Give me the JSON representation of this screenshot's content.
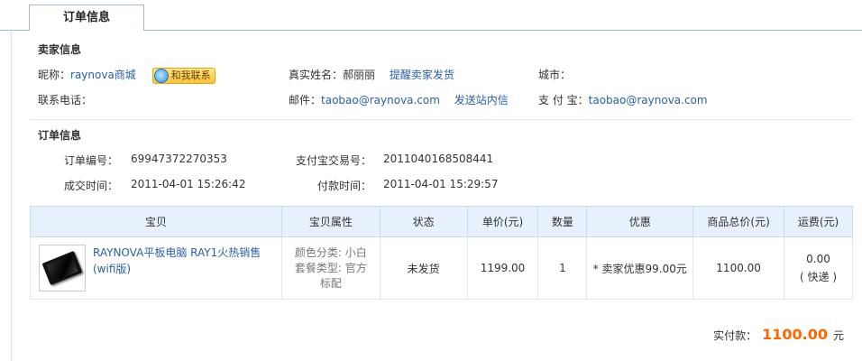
{
  "tab": {
    "label": "订单信息"
  },
  "seller": {
    "section_title": "卖家信息",
    "nickname_label": "昵称：",
    "nickname": "raynova商城",
    "contact_badge": "和我联系",
    "realname_label": "真实姓名：",
    "realname": "郝丽丽",
    "remind_link": "提醒卖家发货",
    "city_label": "城市：",
    "phone_label": "联系电话：",
    "email_label": "邮件：",
    "email": "taobao@raynova.com",
    "message_link": "发送站内信",
    "alipay_label": "支 付 宝：",
    "alipay": "taobao@raynova.com"
  },
  "order": {
    "section_title": "订单信息",
    "order_no_label": "订单编号：",
    "order_no": "69947372270353",
    "alipay_trade_label": "支付宝交易号：",
    "alipay_trade_no": "2011040168508441",
    "deal_time_label": "成交时间：",
    "deal_time": "2011-04-01 15:26:42",
    "pay_time_label": "付款时间：",
    "pay_time": "2011-04-01 15:29:57"
  },
  "table": {
    "headers": [
      "宝贝",
      "宝贝属性",
      "状态",
      "单价(元)",
      "数量",
      "优惠",
      "商品总价(元)",
      "运费(元)"
    ],
    "row": {
      "title": "RAYNOVA平板电脑 RAY1火热销售(wifi版)",
      "attr_line1": "颜色分类: 小白",
      "attr_line2": "套餐类型: 官方",
      "attr_line3": "标配",
      "status": "未发货",
      "price": "1199.00",
      "qty": "1",
      "discount": "* 卖家优惠99.00元",
      "subtotal": "1100.00",
      "shipping": "0.00",
      "shipping_method": "( 快递 )"
    }
  },
  "total": {
    "label": "实付款：",
    "amount": "1100.00",
    "unit": "元"
  }
}
